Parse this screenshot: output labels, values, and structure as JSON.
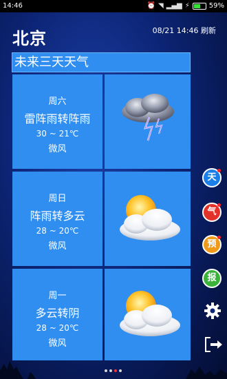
{
  "status_bar": {
    "time": "14:46",
    "battery": "59%",
    "battery_level": 0.59
  },
  "city": "北京",
  "refresh_info": "08/21 14:46 刷新",
  "section_title": "未来三天天气",
  "days": [
    {
      "day": "周六",
      "condition": "雷阵雨转阵雨",
      "temp": "30 ~ 21℃",
      "wind": "微风",
      "icon": "thunderstorm-icon"
    },
    {
      "day": "周日",
      "condition": "阵雨转多云",
      "temp": "28 ~ 20℃",
      "wind": "微风",
      "icon": "sun-cloud-icon"
    },
    {
      "day": "周一",
      "condition": "多云转阴",
      "temp": "28 ~ 20℃",
      "wind": "微风",
      "icon": "sun-cloud-icon"
    }
  ],
  "side_buttons": [
    {
      "label": "天",
      "color": "#1a7fe8",
      "dot": true
    },
    {
      "label": "气",
      "color": "#e2322a",
      "dot": true
    },
    {
      "label": "预",
      "color": "#f09a1a",
      "dot": true
    },
    {
      "label": "报",
      "color": "#3bb33b",
      "dot": false
    }
  ],
  "icons": {
    "settings": "gear-icon",
    "exit": "exit-icon"
  },
  "pager": {
    "count": 4,
    "active": 2
  }
}
